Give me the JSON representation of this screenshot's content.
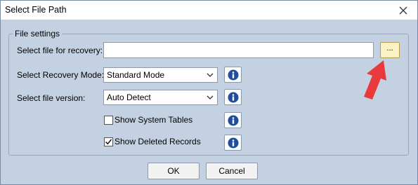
{
  "window": {
    "title": "Select File Path"
  },
  "group": {
    "legend": "File settings"
  },
  "file_row": {
    "label": "Select file for recovery:",
    "value": "",
    "browse_label": "..."
  },
  "mode_row": {
    "label": "Select Recovery Mode:",
    "selected": "Standard Mode"
  },
  "version_row": {
    "label": "Select file version:",
    "selected": "Auto Detect"
  },
  "checkboxes": {
    "system_tables": {
      "label": "Show System Tables",
      "checked": false
    },
    "deleted_records": {
      "label": "Show Deleted Records",
      "checked": true
    }
  },
  "footer": {
    "ok_label": "OK",
    "cancel_label": "Cancel"
  },
  "icons": {
    "info": "info-icon",
    "close": "close-icon",
    "chevron": "chevron-down-icon",
    "check": "check-icon",
    "pointer": "arrow-pointer-icon"
  },
  "colors": {
    "dialog_bg": "#c4d1e3",
    "info_blue": "#1f4e9c",
    "arrow_red": "#e83a3a",
    "browse_bg": "#fbf2c4"
  }
}
